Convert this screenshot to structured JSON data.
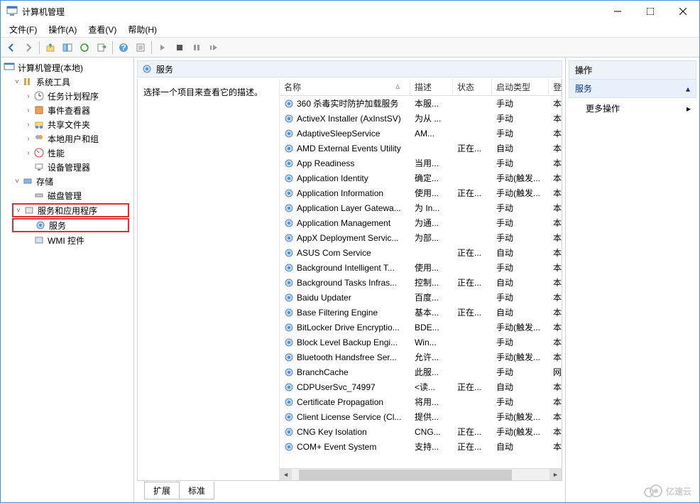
{
  "window": {
    "title": "计算机管理"
  },
  "menu": {
    "file": "文件(F)",
    "action": "操作(A)",
    "view": "查看(V)",
    "help": "帮助(H)"
  },
  "tree": {
    "root": "计算机管理(本地)",
    "system_tools": "系统工具",
    "task_scheduler": "任务计划程序",
    "event_viewer": "事件查看器",
    "shared_folders": "共享文件夹",
    "local_users": "本地用户和组",
    "performance": "性能",
    "device_manager": "设备管理器",
    "storage": "存储",
    "disk_management": "磁盘管理",
    "services_apps": "服务和应用程序",
    "services": "服务",
    "wmi": "WMI 控件"
  },
  "center": {
    "header": "服务",
    "desc_prompt": "选择一个项目来查看它的描述。"
  },
  "columns": {
    "name": "名称",
    "description": "描述",
    "status": "状态",
    "startup": "启动类型",
    "logon": "登"
  },
  "services_list": [
    {
      "name": "360 杀毒实时防护加载服务",
      "desc": "本服...",
      "status": "",
      "startup": "手动",
      "logon": "本"
    },
    {
      "name": "ActiveX Installer (AxInstSV)",
      "desc": "为从 ...",
      "status": "",
      "startup": "手动",
      "logon": "本"
    },
    {
      "name": "AdaptiveSleepService",
      "desc": "AM...",
      "status": "",
      "startup": "手动",
      "logon": "本"
    },
    {
      "name": "AMD External Events Utility",
      "desc": "",
      "status": "正在...",
      "startup": "自动",
      "logon": "本"
    },
    {
      "name": "App Readiness",
      "desc": "当用...",
      "status": "",
      "startup": "手动",
      "logon": "本"
    },
    {
      "name": "Application Identity",
      "desc": "确定...",
      "status": "",
      "startup": "手动(触发...",
      "logon": "本"
    },
    {
      "name": "Application Information",
      "desc": "使用...",
      "status": "正在...",
      "startup": "手动(触发...",
      "logon": "本"
    },
    {
      "name": "Application Layer Gatewa...",
      "desc": "为 In...",
      "status": "",
      "startup": "手动",
      "logon": "本"
    },
    {
      "name": "Application Management",
      "desc": "为通...",
      "status": "",
      "startup": "手动",
      "logon": "本"
    },
    {
      "name": "AppX Deployment Servic...",
      "desc": "为部...",
      "status": "",
      "startup": "手动",
      "logon": "本"
    },
    {
      "name": "ASUS Com Service",
      "desc": "",
      "status": "正在...",
      "startup": "自动",
      "logon": "本"
    },
    {
      "name": "Background Intelligent T...",
      "desc": "使用...",
      "status": "",
      "startup": "手动",
      "logon": "本"
    },
    {
      "name": "Background Tasks Infras...",
      "desc": "控制...",
      "status": "正在...",
      "startup": "自动",
      "logon": "本"
    },
    {
      "name": "Baidu Updater",
      "desc": "百度...",
      "status": "",
      "startup": "手动",
      "logon": "本"
    },
    {
      "name": "Base Filtering Engine",
      "desc": "基本...",
      "status": "正在...",
      "startup": "自动",
      "logon": "本"
    },
    {
      "name": "BitLocker Drive Encryptio...",
      "desc": "BDE...",
      "status": "",
      "startup": "手动(触发...",
      "logon": "本"
    },
    {
      "name": "Block Level Backup Engi...",
      "desc": "Win...",
      "status": "",
      "startup": "手动",
      "logon": "本"
    },
    {
      "name": "Bluetooth Handsfree Ser...",
      "desc": "允许...",
      "status": "",
      "startup": "手动(触发...",
      "logon": "本"
    },
    {
      "name": "BranchCache",
      "desc": "此服...",
      "status": "",
      "startup": "手动",
      "logon": "网"
    },
    {
      "name": "CDPUserSvc_74997",
      "desc": "<读...",
      "status": "正在...",
      "startup": "自动",
      "logon": "本"
    },
    {
      "name": "Certificate Propagation",
      "desc": "将用...",
      "status": "",
      "startup": "手动",
      "logon": "本"
    },
    {
      "name": "Client License Service (Cl...",
      "desc": "提供...",
      "status": "",
      "startup": "手动(触发...",
      "logon": "本"
    },
    {
      "name": "CNG Key Isolation",
      "desc": "CNG...",
      "status": "正在...",
      "startup": "手动(触发...",
      "logon": "本"
    },
    {
      "name": "COM+ Event System",
      "desc": "支持...",
      "status": "正在...",
      "startup": "自动",
      "logon": "本"
    }
  ],
  "tabs": {
    "extended": "扩展",
    "standard": "标准"
  },
  "actions": {
    "header": "操作",
    "services": "服务",
    "more": "更多操作"
  },
  "watermark": "亿速云"
}
